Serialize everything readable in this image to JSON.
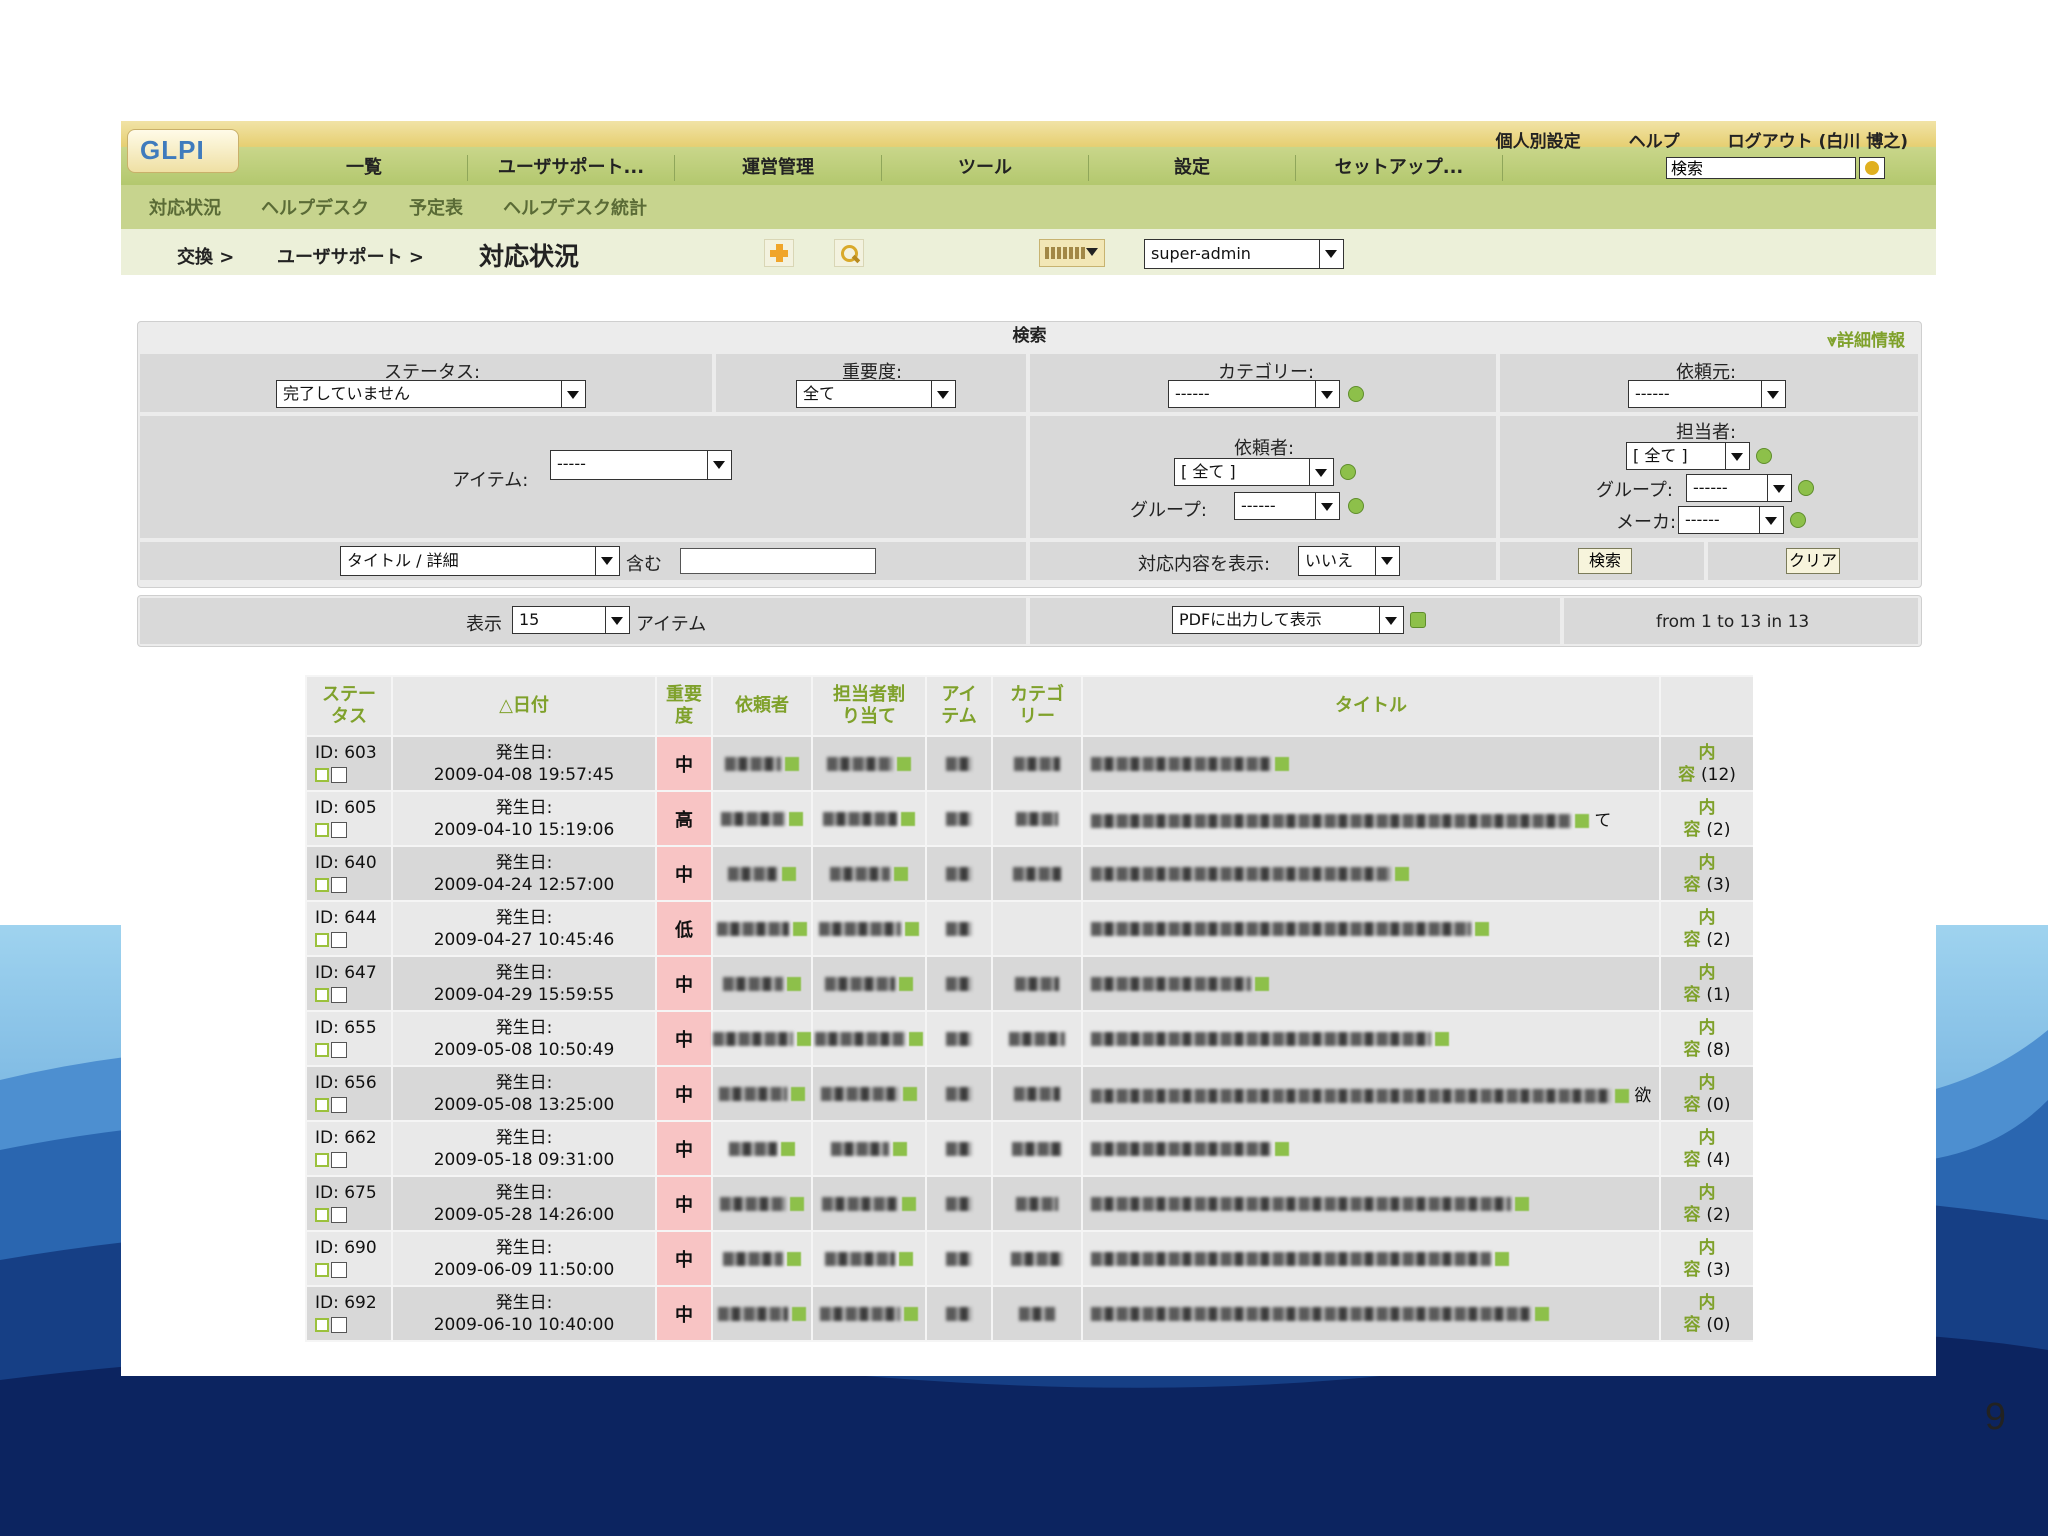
{
  "slide": {
    "page_number": "9"
  },
  "header": {
    "logo_text": "GLPI",
    "top_links": [
      "個人別設定",
      "ヘルプ",
      "ログアウト (白川 博之)"
    ],
    "menu": [
      "一覧",
      "ユーザサポート...",
      "運営管理",
      "ツール",
      "設定",
      "セットアップ..."
    ],
    "search_value": "検索"
  },
  "subnav": [
    "対応状況",
    "ヘルプデスク",
    "予定表",
    "ヘルプデスク統計"
  ],
  "breadcrumb": {
    "items": [
      "交換 >",
      "ユーザサポート >"
    ],
    "current": "対応状況",
    "entity_select": "super-admin"
  },
  "search_form": {
    "title": "検索",
    "detail_link": "詳細情報",
    "status_label": "ステータス:",
    "status_value": "完了していません",
    "priority_label": "重要度:",
    "priority_value": "全て",
    "category_label": "カテゴリー:",
    "category_value": "------",
    "source_label": "依頼元:",
    "source_value": "------",
    "item_label": "アイテム:",
    "item_value": "-----",
    "requester_label": "依頼者:",
    "requester_value": "[ 全て ]",
    "requester_group_label": "グループ:",
    "requester_group_value": "------",
    "assignee_label": "担当者:",
    "assignee_value": "[ 全て ]",
    "assignee_group_label": "グループ:",
    "assignee_group_value": "------",
    "maker_label": "メーカ:",
    "maker_value": "------",
    "text_field_value": "タイトル / 詳細",
    "contains_label": "含む",
    "contains_value": "",
    "show_followups_label": "対応内容を表示:",
    "show_followups_value": "いいえ",
    "search_button": "検索",
    "clear_button": "クリア"
  },
  "display_bar": {
    "show_label": "表示",
    "per_page": "15",
    "items_label": "アイテム",
    "export_value": "PDFに出力して表示",
    "pagination": "from 1 to 13 in 13"
  },
  "table": {
    "headers": [
      "ステー\nタス",
      "△日付",
      "重要\n度",
      "依頼者",
      "担当者割\nり当て",
      "アイ\nテム",
      "カテゴ\nリー",
      "タイトル",
      ""
    ],
    "rows": [
      {
        "id": "ID: 603",
        "date_label": "発生日:",
        "date": "2009-04-08 19:57:45",
        "priority": "中",
        "content": "内",
        "content2": "容",
        "count": "(12)",
        "title_extra": ""
      },
      {
        "id": "ID: 605",
        "date_label": "発生日:",
        "date": "2009-04-10 15:19:06",
        "priority": "高",
        "content": "内",
        "content2": "容",
        "count": "(2)",
        "title_extra": "て"
      },
      {
        "id": "ID: 640",
        "date_label": "発生日:",
        "date": "2009-04-24 12:57:00",
        "priority": "中",
        "content": "内",
        "content2": "容",
        "count": "(3)",
        "title_extra": ""
      },
      {
        "id": "ID: 644",
        "date_label": "発生日:",
        "date": "2009-04-27 10:45:46",
        "priority": "低",
        "content": "内",
        "content2": "容",
        "count": "(2)",
        "title_extra": ""
      },
      {
        "id": "ID: 647",
        "date_label": "発生日:",
        "date": "2009-04-29 15:59:55",
        "priority": "中",
        "content": "内",
        "content2": "容",
        "count": "(1)",
        "title_extra": ""
      },
      {
        "id": "ID: 655",
        "date_label": "発生日:",
        "date": "2009-05-08 10:50:49",
        "priority": "中",
        "content": "内",
        "content2": "容",
        "count": "(8)",
        "title_extra": ""
      },
      {
        "id": "ID: 656",
        "date_label": "発生日:",
        "date": "2009-05-08 13:25:00",
        "priority": "中",
        "content": "内",
        "content2": "容",
        "count": "(0)",
        "title_extra": "欲"
      },
      {
        "id": "ID: 662",
        "date_label": "発生日:",
        "date": "2009-05-18 09:31:00",
        "priority": "中",
        "content": "内",
        "content2": "容",
        "count": "(4)",
        "title_extra": ""
      },
      {
        "id": "ID: 675",
        "date_label": "発生日:",
        "date": "2009-05-28 14:26:00",
        "priority": "中",
        "content": "内",
        "content2": "容",
        "count": "(2)",
        "title_extra": ""
      },
      {
        "id": "ID: 690",
        "date_label": "発生日:",
        "date": "2009-06-09 11:50:00",
        "priority": "中",
        "content": "内",
        "content2": "容",
        "count": "(3)",
        "title_extra": ""
      },
      {
        "id": "ID: 692",
        "date_label": "発生日:",
        "date": "2009-06-10 10:40:00",
        "priority": "中",
        "content": "内",
        "content2": "容",
        "count": "(0)",
        "title_extra": ""
      }
    ]
  }
}
